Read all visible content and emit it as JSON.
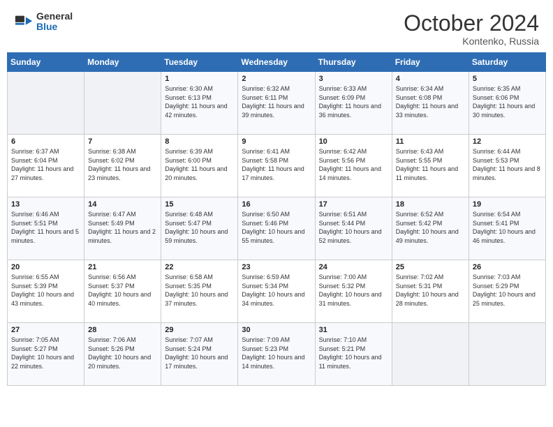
{
  "header": {
    "logo_general": "General",
    "logo_blue": "Blue",
    "month": "October 2024",
    "location": "Kontenko, Russia"
  },
  "days_of_week": [
    "Sunday",
    "Monday",
    "Tuesday",
    "Wednesday",
    "Thursday",
    "Friday",
    "Saturday"
  ],
  "weeks": [
    [
      {
        "day": "",
        "sunrise": "",
        "sunset": "",
        "daylight": ""
      },
      {
        "day": "",
        "sunrise": "",
        "sunset": "",
        "daylight": ""
      },
      {
        "day": "1",
        "sunrise": "Sunrise: 6:30 AM",
        "sunset": "Sunset: 6:13 PM",
        "daylight": "Daylight: 11 hours and 42 minutes."
      },
      {
        "day": "2",
        "sunrise": "Sunrise: 6:32 AM",
        "sunset": "Sunset: 6:11 PM",
        "daylight": "Daylight: 11 hours and 39 minutes."
      },
      {
        "day": "3",
        "sunrise": "Sunrise: 6:33 AM",
        "sunset": "Sunset: 6:09 PM",
        "daylight": "Daylight: 11 hours and 36 minutes."
      },
      {
        "day": "4",
        "sunrise": "Sunrise: 6:34 AM",
        "sunset": "Sunset: 6:08 PM",
        "daylight": "Daylight: 11 hours and 33 minutes."
      },
      {
        "day": "5",
        "sunrise": "Sunrise: 6:35 AM",
        "sunset": "Sunset: 6:06 PM",
        "daylight": "Daylight: 11 hours and 30 minutes."
      }
    ],
    [
      {
        "day": "6",
        "sunrise": "Sunrise: 6:37 AM",
        "sunset": "Sunset: 6:04 PM",
        "daylight": "Daylight: 11 hours and 27 minutes."
      },
      {
        "day": "7",
        "sunrise": "Sunrise: 6:38 AM",
        "sunset": "Sunset: 6:02 PM",
        "daylight": "Daylight: 11 hours and 23 minutes."
      },
      {
        "day": "8",
        "sunrise": "Sunrise: 6:39 AM",
        "sunset": "Sunset: 6:00 PM",
        "daylight": "Daylight: 11 hours and 20 minutes."
      },
      {
        "day": "9",
        "sunrise": "Sunrise: 6:41 AM",
        "sunset": "Sunset: 5:58 PM",
        "daylight": "Daylight: 11 hours and 17 minutes."
      },
      {
        "day": "10",
        "sunrise": "Sunrise: 6:42 AM",
        "sunset": "Sunset: 5:56 PM",
        "daylight": "Daylight: 11 hours and 14 minutes."
      },
      {
        "day": "11",
        "sunrise": "Sunrise: 6:43 AM",
        "sunset": "Sunset: 5:55 PM",
        "daylight": "Daylight: 11 hours and 11 minutes."
      },
      {
        "day": "12",
        "sunrise": "Sunrise: 6:44 AM",
        "sunset": "Sunset: 5:53 PM",
        "daylight": "Daylight: 11 hours and 8 minutes."
      }
    ],
    [
      {
        "day": "13",
        "sunrise": "Sunrise: 6:46 AM",
        "sunset": "Sunset: 5:51 PM",
        "daylight": "Daylight: 11 hours and 5 minutes."
      },
      {
        "day": "14",
        "sunrise": "Sunrise: 6:47 AM",
        "sunset": "Sunset: 5:49 PM",
        "daylight": "Daylight: 11 hours and 2 minutes."
      },
      {
        "day": "15",
        "sunrise": "Sunrise: 6:48 AM",
        "sunset": "Sunset: 5:47 PM",
        "daylight": "Daylight: 10 hours and 59 minutes."
      },
      {
        "day": "16",
        "sunrise": "Sunrise: 6:50 AM",
        "sunset": "Sunset: 5:46 PM",
        "daylight": "Daylight: 10 hours and 55 minutes."
      },
      {
        "day": "17",
        "sunrise": "Sunrise: 6:51 AM",
        "sunset": "Sunset: 5:44 PM",
        "daylight": "Daylight: 10 hours and 52 minutes."
      },
      {
        "day": "18",
        "sunrise": "Sunrise: 6:52 AM",
        "sunset": "Sunset: 5:42 PM",
        "daylight": "Daylight: 10 hours and 49 minutes."
      },
      {
        "day": "19",
        "sunrise": "Sunrise: 6:54 AM",
        "sunset": "Sunset: 5:41 PM",
        "daylight": "Daylight: 10 hours and 46 minutes."
      }
    ],
    [
      {
        "day": "20",
        "sunrise": "Sunrise: 6:55 AM",
        "sunset": "Sunset: 5:39 PM",
        "daylight": "Daylight: 10 hours and 43 minutes."
      },
      {
        "day": "21",
        "sunrise": "Sunrise: 6:56 AM",
        "sunset": "Sunset: 5:37 PM",
        "daylight": "Daylight: 10 hours and 40 minutes."
      },
      {
        "day": "22",
        "sunrise": "Sunrise: 6:58 AM",
        "sunset": "Sunset: 5:35 PM",
        "daylight": "Daylight: 10 hours and 37 minutes."
      },
      {
        "day": "23",
        "sunrise": "Sunrise: 6:59 AM",
        "sunset": "Sunset: 5:34 PM",
        "daylight": "Daylight: 10 hours and 34 minutes."
      },
      {
        "day": "24",
        "sunrise": "Sunrise: 7:00 AM",
        "sunset": "Sunset: 5:32 PM",
        "daylight": "Daylight: 10 hours and 31 minutes."
      },
      {
        "day": "25",
        "sunrise": "Sunrise: 7:02 AM",
        "sunset": "Sunset: 5:31 PM",
        "daylight": "Daylight: 10 hours and 28 minutes."
      },
      {
        "day": "26",
        "sunrise": "Sunrise: 7:03 AM",
        "sunset": "Sunset: 5:29 PM",
        "daylight": "Daylight: 10 hours and 25 minutes."
      }
    ],
    [
      {
        "day": "27",
        "sunrise": "Sunrise: 7:05 AM",
        "sunset": "Sunset: 5:27 PM",
        "daylight": "Daylight: 10 hours and 22 minutes."
      },
      {
        "day": "28",
        "sunrise": "Sunrise: 7:06 AM",
        "sunset": "Sunset: 5:26 PM",
        "daylight": "Daylight: 10 hours and 20 minutes."
      },
      {
        "day": "29",
        "sunrise": "Sunrise: 7:07 AM",
        "sunset": "Sunset: 5:24 PM",
        "daylight": "Daylight: 10 hours and 17 minutes."
      },
      {
        "day": "30",
        "sunrise": "Sunrise: 7:09 AM",
        "sunset": "Sunset: 5:23 PM",
        "daylight": "Daylight: 10 hours and 14 minutes."
      },
      {
        "day": "31",
        "sunrise": "Sunrise: 7:10 AM",
        "sunset": "Sunset: 5:21 PM",
        "daylight": "Daylight: 10 hours and 11 minutes."
      },
      {
        "day": "",
        "sunrise": "",
        "sunset": "",
        "daylight": ""
      },
      {
        "day": "",
        "sunrise": "",
        "sunset": "",
        "daylight": ""
      }
    ]
  ]
}
